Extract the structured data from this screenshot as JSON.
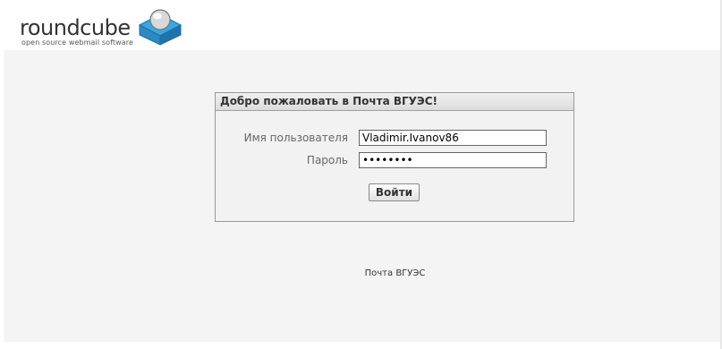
{
  "logo": {
    "wordmark": "roundcube",
    "tagline": "open source webmail software"
  },
  "login": {
    "title": "Добро пожаловать в Почта ВГУЭС!",
    "username_label": "Имя пользователя",
    "username_value": "Vladimir.Ivanov86",
    "password_label": "Пароль",
    "password_value": "••••••••",
    "submit_label": "Войти"
  },
  "footer": {
    "text": "Почта ВГУЭС"
  },
  "colors": {
    "logo_blue": "#37a5d6",
    "panel_bg": "#f2f2f2",
    "page_bg": "#f4f4f4"
  }
}
